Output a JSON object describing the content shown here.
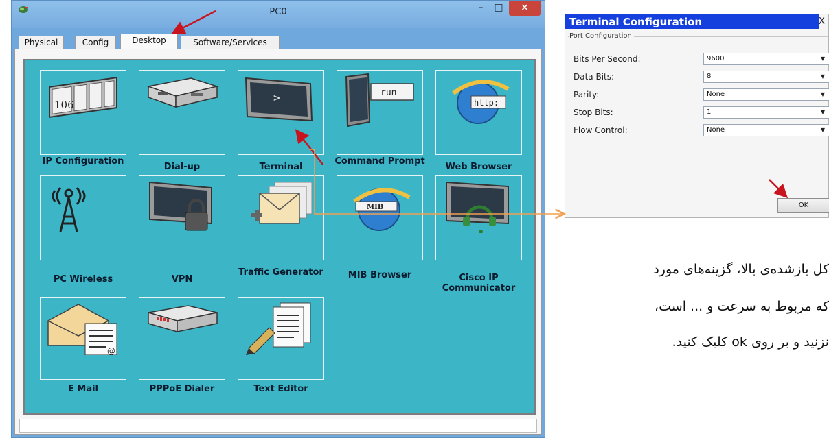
{
  "window": {
    "title": "PC0"
  },
  "tabs": [
    "Physical",
    "Config",
    "Desktop",
    "Software/Services"
  ],
  "apps": [
    {
      "label": "IP Configuration",
      "icon": "ip-configuration-icon",
      "badge": "106"
    },
    {
      "label": "Dial-up",
      "icon": "dialup-modem-icon"
    },
    {
      "label": "Terminal",
      "icon": "terminal-icon",
      "glyph": ">"
    },
    {
      "label": "Command Prompt",
      "icon": "command-prompt-icon",
      "glyph": "run"
    },
    {
      "label": "Web Browser",
      "icon": "web-browser-icon",
      "glyph": "http:"
    },
    {
      "label": "PC Wireless",
      "icon": "wireless-antenna-icon"
    },
    {
      "label": "VPN",
      "icon": "vpn-lock-icon"
    },
    {
      "label": "Traffic Generator",
      "icon": "traffic-generator-icon"
    },
    {
      "label": "MIB Browser",
      "icon": "mib-browser-icon",
      "glyph": "MIB"
    },
    {
      "label": "Cisco IP Communicator",
      "icon": "ip-communicator-headset-icon"
    },
    {
      "label": "E Mail",
      "icon": "email-icon",
      "glyph": "@"
    },
    {
      "label": "PPPoE Dialer",
      "icon": "pppoe-dialer-icon"
    },
    {
      "label": "Text Editor",
      "icon": "text-editor-icon"
    }
  ],
  "dialog": {
    "title": "Terminal Configuration",
    "close": "X",
    "group": "Port Configuration",
    "fields": [
      {
        "label": "Bits Per Second:",
        "value": "9600"
      },
      {
        "label": "Data Bits:",
        "value": "8"
      },
      {
        "label": "Parity:",
        "value": "None"
      },
      {
        "label": "Stop Bits:",
        "value": "1"
      },
      {
        "label": "Flow Control:",
        "value": "None"
      }
    ],
    "ok": "OK"
  },
  "caption": [
    "کل بازشده‌ی بالا، گزینه‌های مورد",
    "که مربوط به سرعت و ... است،",
    "نزنید و بر روی ok کلیک کنید."
  ],
  "colors": {
    "panel": "#3cb6c6",
    "dialog_title": "#1640de",
    "arrow_red": "#c8141e",
    "connector_orange": "#f0a050"
  }
}
